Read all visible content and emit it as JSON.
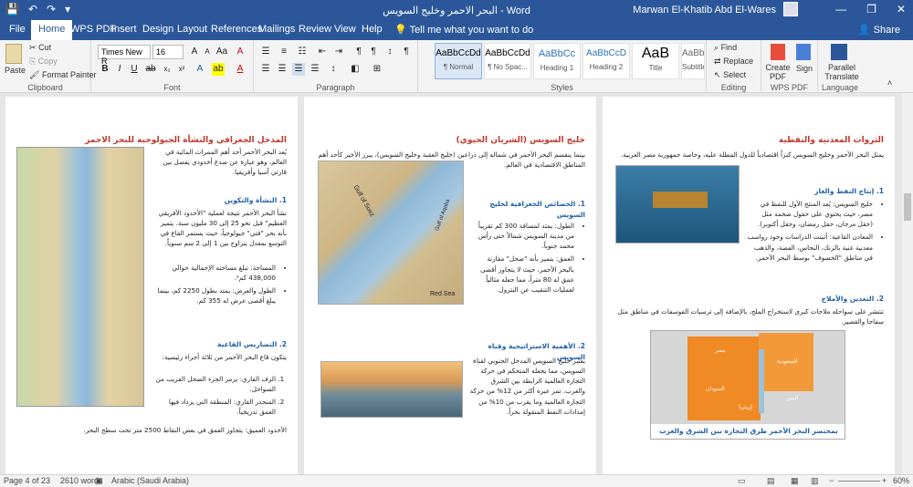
{
  "titlebar": {
    "title": "البحر الاحمر وخليج السويس  -  Word",
    "user": "Marwan El-Khatib Abd El-Wares",
    "qat": [
      "💾",
      "↶",
      "↷",
      "▾"
    ],
    "win": [
      "—",
      "❐",
      "✕"
    ]
  },
  "tabs": [
    "File",
    "Home",
    "WPS PDF",
    "Insert",
    "Design",
    "Layout",
    "References",
    "Mailings",
    "Review",
    "View",
    "Help"
  ],
  "tell_me": "Tell me what you want to do",
  "share": "Share",
  "ribbon": {
    "clipboard": {
      "paste": "Paste",
      "cut": "Cut",
      "copy": "Copy",
      "painter": "Format Painter",
      "label": "Clipboard"
    },
    "font": {
      "name": "Times New R",
      "size": "16",
      "label": "Font"
    },
    "paragraph": {
      "label": "Paragraph"
    },
    "styles": {
      "label": "Styles",
      "items": [
        {
          "preview": "AaBbCcDd",
          "name": "¶ Normal"
        },
        {
          "preview": "AaBbCcDd",
          "name": "¶ No Spac..."
        },
        {
          "preview": "AaBbCc",
          "name": "Heading 1"
        },
        {
          "preview": "AaBbCcD",
          "name": "Heading 2"
        },
        {
          "preview": "AaB",
          "name": "Title"
        },
        {
          "preview": "AaBbCcD",
          "name": "Subtitle"
        }
      ]
    },
    "editing": {
      "find": "Find",
      "replace": "Replace",
      "select": "Select",
      "label": "Editing"
    },
    "wps": {
      "create": "Create PDF",
      "sign": "Sign",
      "label": "WPS PDF"
    },
    "language": {
      "translate": "Parallel Translate",
      "label": "Language"
    }
  },
  "pages": {
    "left": {
      "title": "المدخل الجغرافي والنشأة الجيولوجية للبحر الاحمر",
      "intro": "يُعد البحر الأحمر أحد أهم الممرات المائية في العالم، وهو عبارة عن صدع أخدودي يفصل بين قارتي آسيا وأفريقيا.",
      "h_origin": "1. النشأة والتكوين",
      "origin": "نشأ البحر الأحمر نتيجة لعملية \"الأخدود الأفريقي العظيم\" قبل نحو 25 إلى 30 مليون سنة. يتميز بأنه بحر \"فتي\" جيولوجياً، حيث يستمر القاع في التوسع بمعدل يتراوح بين 1 إلى 2 سم سنوياً.",
      "area": "المساحة: تبلغ مساحته الإجمالية حوالي 438,000 كم².",
      "length": "الطول والعرض: يمتد بطول 2250 كم، بينما يبلغ أقصى عرض له 355 كم.",
      "h_relief": "2. التضاريس القاعية",
      "relief": "يتكون قاع البحر الأحمر من ثلاثة أجزاء رئيسية:",
      "r1": "الرف القاري: يرمز الجزء الضحل القريب من السواحل.",
      "r2": "المنحدر القاري: المنطقة التي يزداد فيها العمق تدريجياً.",
      "r3": "الأخدود العميق: يتجاوز العمق في بعض النقاط 2500 متر تحت سطح البحر."
    },
    "middle": {
      "title": "خليج السويس (الشريان الحيوي)",
      "intro": "بينما ينقسم البحر الأحمر في شماله إلى ذراعين (خليج العقبة وخليج السويس)، يبرز الأخير كأحد أهم المناطق الاقتصادية في العالم.",
      "h_geo": "1. الخصائص الجغرافية لخليج السويس",
      "g1": "الطول: يمتد لمسافة 300 كم تقريباً من مدينة السويس شمالاً حتى رأس محمد جنوباً.",
      "g2": "العمق: يتميز بأنه \"ضحل\" مقارنة بالبحر الأحمر، حيث لا يتجاوز أقصى عمق له 80 متراً، مما جعله مثالياً لعمليات التنقيب عن البترول.",
      "map_gulf": "Gulf of Suez",
      "map_aqaba": "Gulf of Aqaba",
      "map_red": "Red Sea",
      "h_strat": "2. الأهمية الاستراتيجية وقناة السويس",
      "strat": "يعتبر خليج السويس المدخل الجنوبي لقناة السويس، مما يجعله المتحكم في حركة التجارة العالمية الرابطة بين الشرق والغرب. تمر عبره أكثر من 12% من حركة التجارة العالمية وما يقرب من 10% من إمدادات النفط المنقولة بحراً."
    },
    "right": {
      "title": "الثروات المعدنية والنفطية",
      "intro": "يمثل البحر الأحمر وخليج السويس كنزاً اقتصادياً للدول المطلة عليه، وخاصة جمهورية مصر العربية.",
      "h_oil": "1. إنتاج النفط والغاز",
      "o1": "خليج السويس: يُعد المنتج الأول للنفط في مصر، حيث يحتوي على حقول ضخمة مثل (حقل مرجان، حقل رمضان، وحقل أكتوبر).",
      "o2": "المعادن القاعية: أثبتت الدراسات وجود رواسب معدنية غنية بالزنك، النحاس، الفضة، والذهب في مناطق \"الخسوف\" بوسط البحر الأحمر.",
      "h_mining": "2. التعدين والأملاح",
      "mining": "تنتشر على سواحله ملاحات كبرى لاستخراج الملح، بالإضافة إلى ترسبات الفوسفات في مناطق مثل سفاجا والقصير.",
      "banner": "بمختصر البحر الأحمر طرق التجارة بين الشرق والغرب",
      "m1": "مصر",
      "m2": "السودان",
      "m3": "السعودية",
      "m4": "اليمن",
      "m5": "إريتريا"
    }
  },
  "status": {
    "page": "Page 4 of 23",
    "words": "2610 words",
    "lang": "Arabic (Saudi Arabia)",
    "zoom": "60%"
  }
}
